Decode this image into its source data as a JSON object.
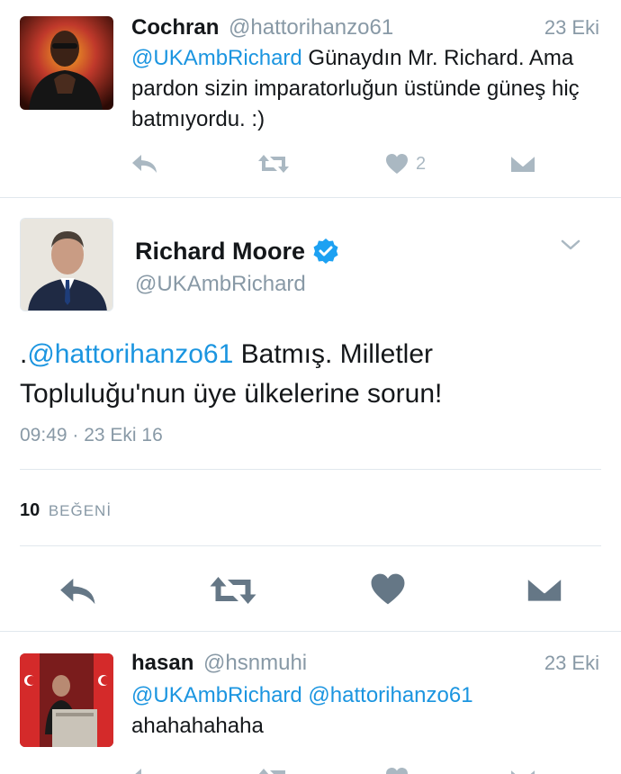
{
  "tweet1": {
    "name": "Cochran",
    "handle": "@hattorihanzo61",
    "date": "23 Eki",
    "mention": "@UKAmbRichard",
    "text": " Günaydın Mr. Richard. Ama pardon sizin imparatorluğun üstünde güneş hiç batmıyordu. :)",
    "like_count": "2"
  },
  "focus": {
    "name": "Richard Moore",
    "handle": "@UKAmbRichard",
    "text_prefix": ".",
    "mention": "@hattorihanzo61",
    "text": " Batmış.  Milletler Topluluğu'nun üye ülkelerine sorun!",
    "timestamp": "09:49 · 23 Eki 16",
    "likes_count": "10",
    "likes_label": "BEĞENİ"
  },
  "tweet3": {
    "name": "hasan",
    "handle": "@hsnmuhi",
    "date": "23 Eki",
    "mention1": "@UKAmbRichard",
    "mention2": "@hattorihanzo61",
    "text": "ahahahahaha"
  },
  "icons": {
    "reply": "reply-icon",
    "retweet": "retweet-icon",
    "like": "heart-icon",
    "dm": "envelope-icon",
    "verified": "verified-badge-icon",
    "caret": "chevron-down-icon"
  },
  "colors": {
    "link": "#1b95e0",
    "muted": "#8899a6",
    "icon": "#aab8c2",
    "icon_dark": "#657786"
  }
}
